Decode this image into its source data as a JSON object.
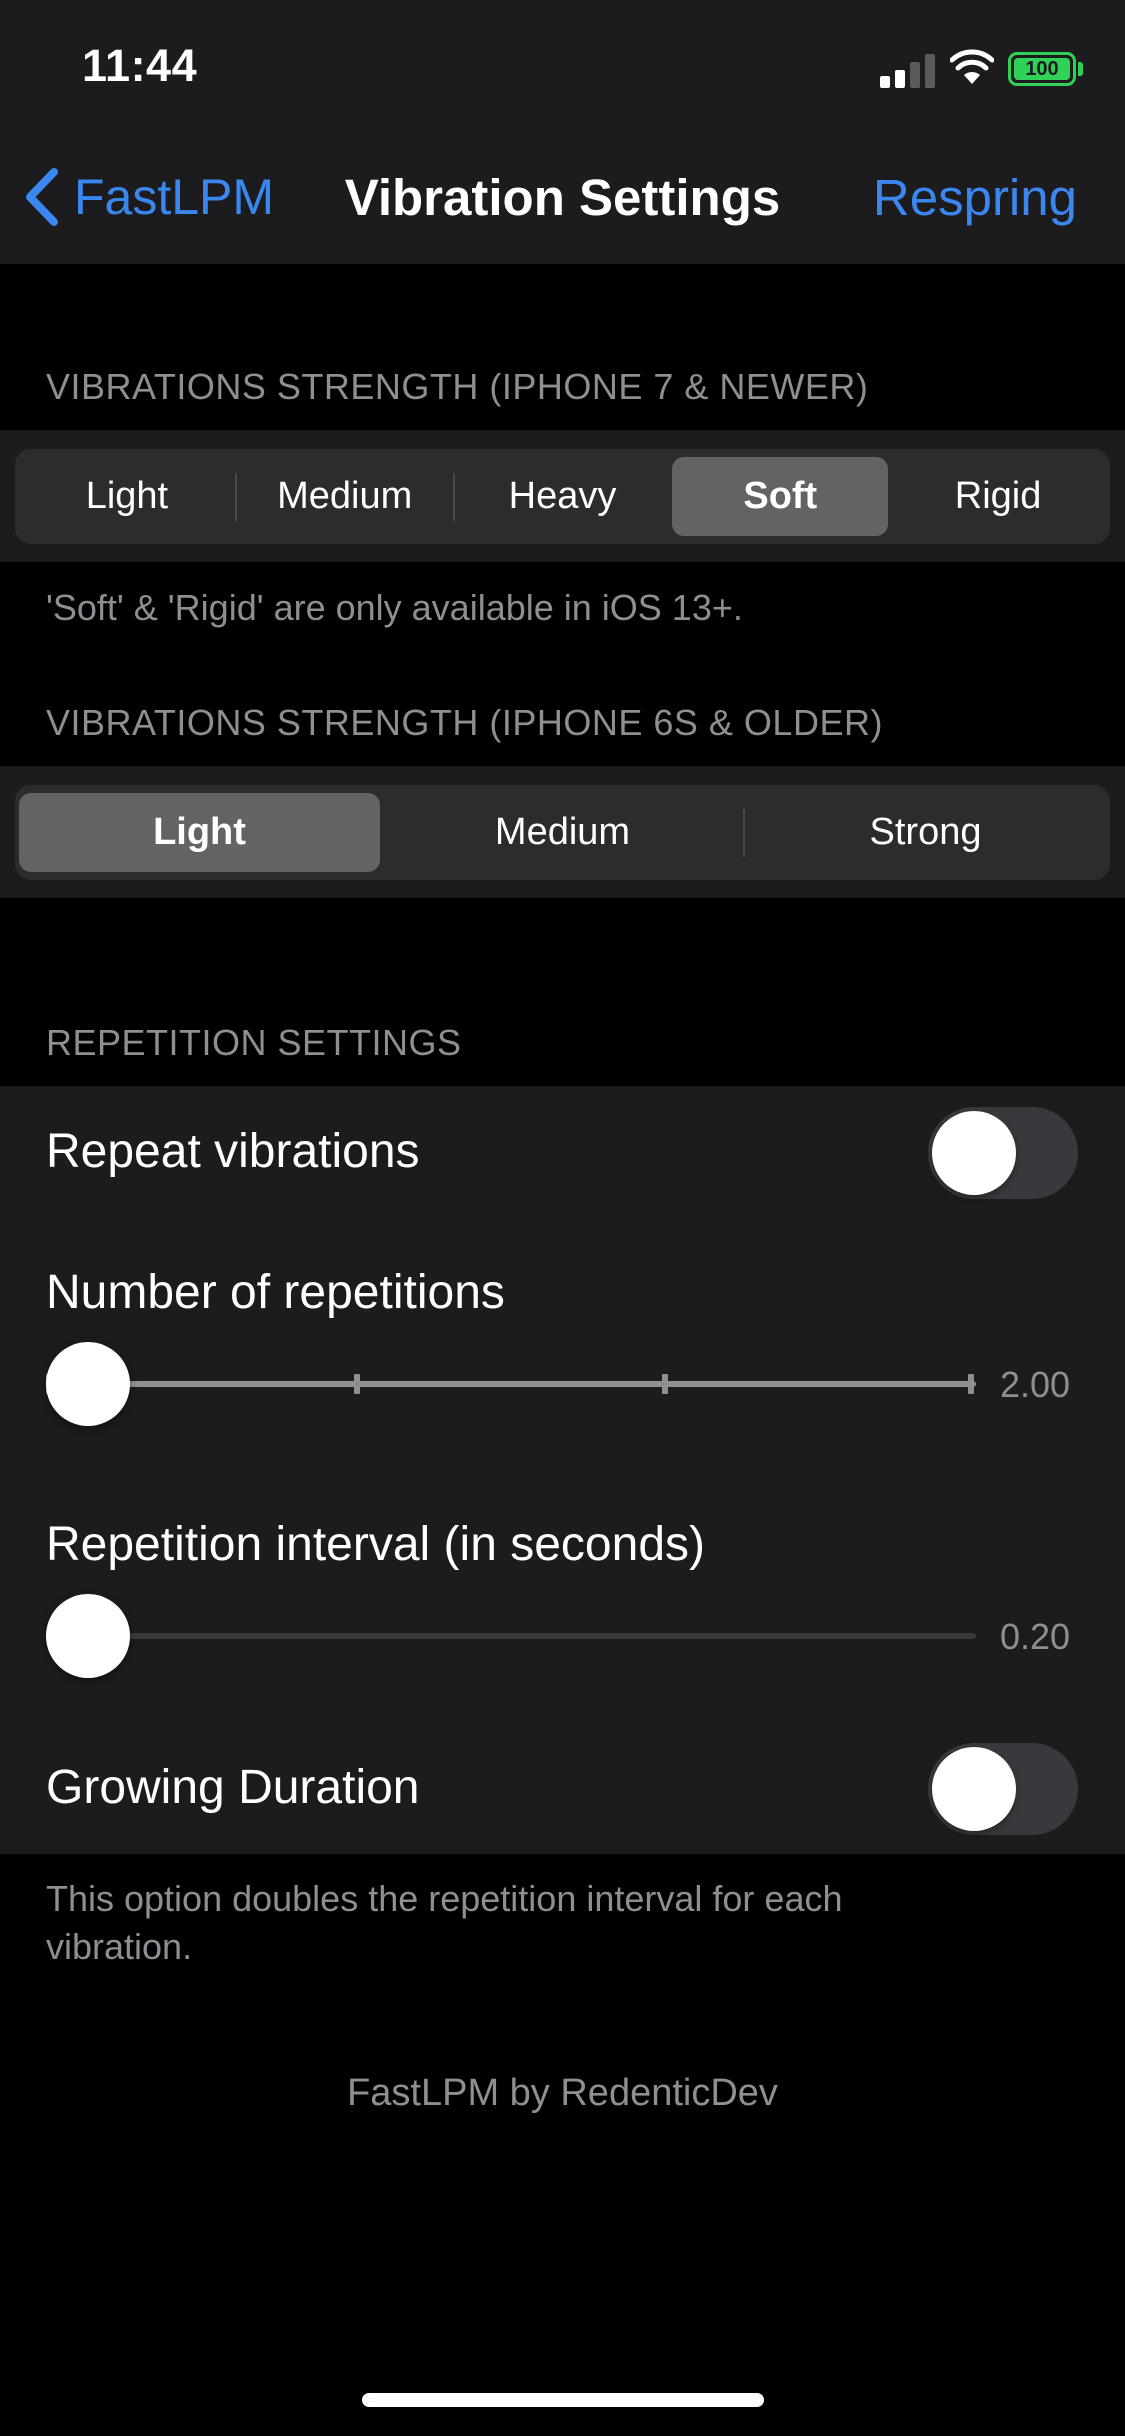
{
  "status_bar": {
    "time": "11:44",
    "battery": "100",
    "battery_color": "#30d158"
  },
  "nav": {
    "back_label": "FastLPM",
    "title": "Vibration Settings",
    "action_label": "Respring",
    "accent_color": "#3a87f0"
  },
  "sections": {
    "strength_new": {
      "header": "VIBRATIONS STRENGTH (IPHONE 7 & NEWER)",
      "options": [
        "Light",
        "Medium",
        "Heavy",
        "Soft",
        "Rigid"
      ],
      "selected": "Soft",
      "footer": "'Soft' & 'Rigid' are only available in iOS 13+."
    },
    "strength_old": {
      "header": "VIBRATIONS STRENGTH (IPHONE 6S & OLDER)",
      "options": [
        "Light",
        "Medium",
        "Strong"
      ],
      "selected": "Light"
    },
    "repetition": {
      "header": "REPETITION SETTINGS",
      "repeat_vibrations": {
        "label": "Repeat vibrations",
        "on": false
      },
      "num_repetitions": {
        "label": "Number of repetitions",
        "value_text": "2.00",
        "value": 2,
        "min": 2,
        "max": 5,
        "step": 1
      },
      "interval": {
        "label": "Repetition interval (in seconds)",
        "value_text": "0.20",
        "value": 0.2
      },
      "growing_duration": {
        "label": "Growing Duration",
        "on": false
      },
      "footer": "This option doubles the repetition interval for each vibration."
    }
  },
  "credit": "FastLPM by RedenticDev"
}
